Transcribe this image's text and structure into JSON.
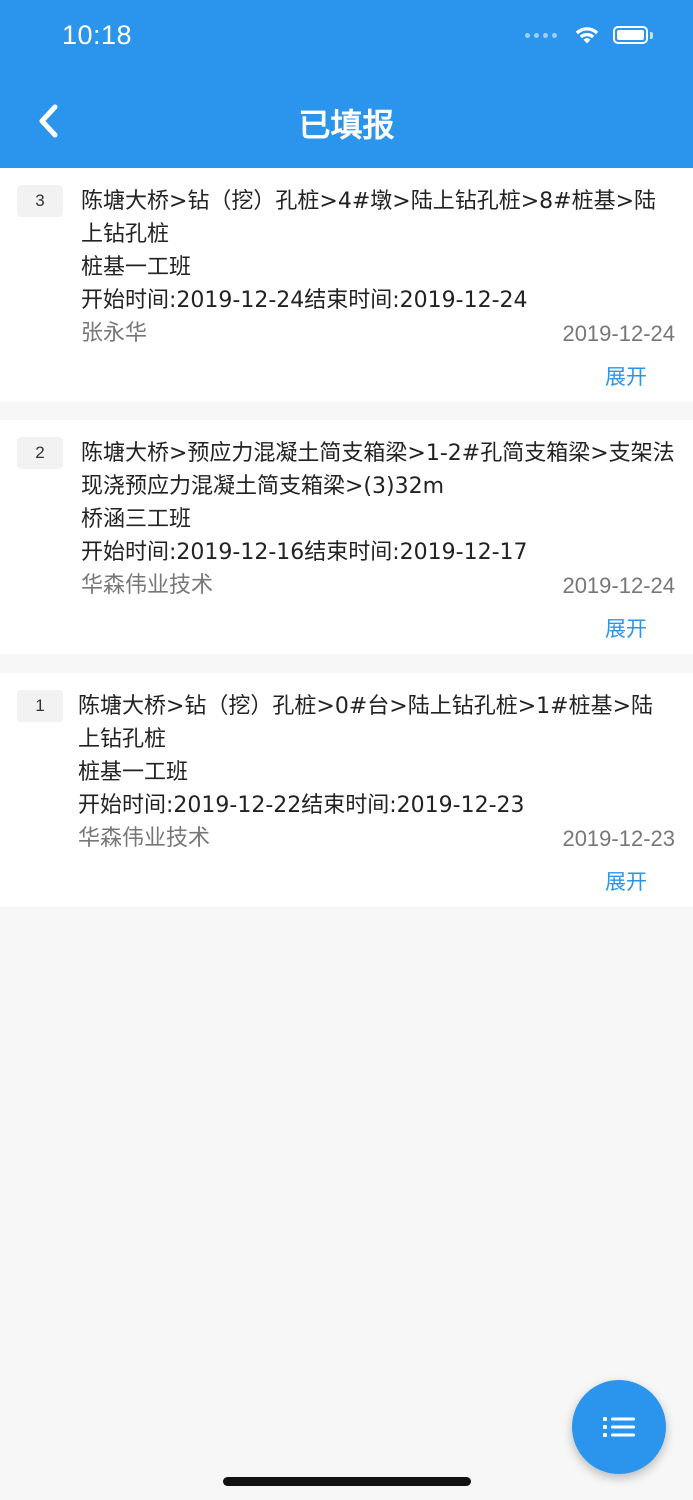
{
  "status_bar": {
    "time": "10:18"
  },
  "header": {
    "title": "已填报"
  },
  "records": [
    {
      "index": "3",
      "path": "陈塘大桥>钻（挖）孔桩>4#墩>陆上钻孔桩>8#桩基>陆上钻孔桩",
      "team": "桩基一工班",
      "period": "开始时间:2019-12-24结束时间:2019-12-24",
      "author": "张永华",
      "date": "2019-12-24",
      "expand_label": "展开"
    },
    {
      "index": "2",
      "path": "陈塘大桥>预应力混凝土简支箱梁>1-2#孔简支箱梁>支架法现浇预应力混凝土简支箱梁>(3)32m",
      "team": "桥涵三工班",
      "period": "开始时间:2019-12-16结束时间:2019-12-17",
      "author": "华森伟业技术",
      "date": "2019-12-24",
      "expand_label": "展开"
    },
    {
      "index": "1",
      "path": "陈塘大桥>钻（挖）孔桩>0#台>陆上钻孔桩>1#桩基>陆上钻孔桩",
      "team": "桩基一工班",
      "period": "开始时间:2019-12-22结束时间:2019-12-23",
      "author": "华森伟业技术",
      "date": "2019-12-23",
      "expand_label": "展开"
    }
  ],
  "colors": {
    "primary": "#2b95ee",
    "background": "#f7f7f7",
    "card": "#ffffff",
    "text": "#222222",
    "muted": "#777777"
  },
  "icons": {
    "back": "chevron-left-icon",
    "fab": "list-icon",
    "wifi": "wifi-icon",
    "battery": "battery-icon"
  }
}
